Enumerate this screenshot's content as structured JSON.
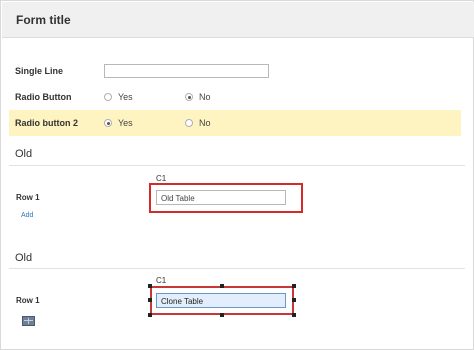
{
  "form": {
    "title": "Form title"
  },
  "fields": {
    "single_line": {
      "label": "Single Line",
      "value": ""
    },
    "radio1": {
      "label": "Radio Button",
      "options": [
        "Yes",
        "No"
      ],
      "selected": "No"
    },
    "radio2": {
      "label": "Radio button 2",
      "options": [
        "Yes",
        "No"
      ],
      "selected": "Yes"
    }
  },
  "sections": [
    {
      "title": "Old",
      "column": "C1",
      "row_label": "Row 1",
      "cell_value": "Old Table",
      "add_label": "Add"
    },
    {
      "title": "Old",
      "column": "C1",
      "row_label": "Row 1",
      "cell_value": "Clone Table",
      "icon": "table-icon"
    }
  ],
  "colors": {
    "highlight": "#fdf4c2",
    "selection": "#d42a2a",
    "link": "#2a78c2"
  }
}
